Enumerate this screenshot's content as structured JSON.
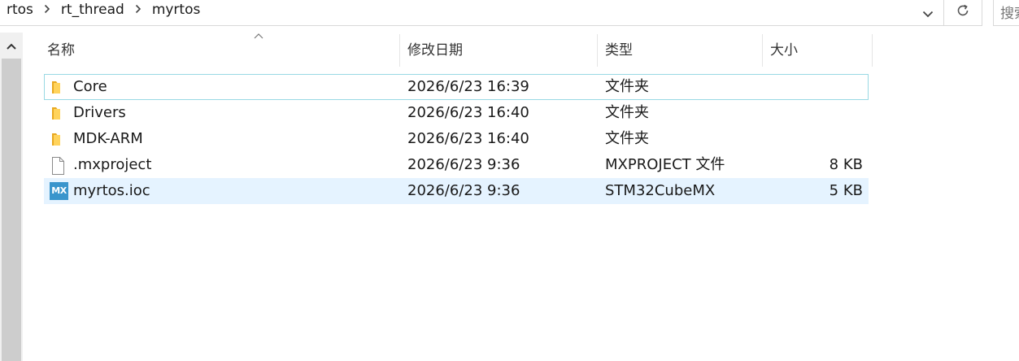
{
  "breadcrumb": {
    "items": [
      "rtos",
      "rt_thread",
      "myrtos"
    ]
  },
  "search": {
    "placeholder": "搜索"
  },
  "columns": {
    "name": "名称",
    "date": "修改日期",
    "type": "类型",
    "size": "大小"
  },
  "files": [
    {
      "name": "Core",
      "date": "2026/6/23 16:39",
      "type": "文件夹",
      "size": "",
      "icon": "folder-icon"
    },
    {
      "name": "Drivers",
      "date": "2026/6/23 16:40",
      "type": "文件夹",
      "size": "",
      "icon": "folder-icon"
    },
    {
      "name": "MDK-ARM",
      "date": "2026/6/23 16:40",
      "type": "文件夹",
      "size": "",
      "icon": "folder-icon"
    },
    {
      "name": ".mxproject",
      "date": "2026/6/23 9:36",
      "type": "MXPROJECT 文件",
      "size": "8 KB",
      "icon": "file-icon"
    },
    {
      "name": "myrtos.ioc",
      "date": "2026/6/23 9:36",
      "type": "STM32CubeMX",
      "size": "5 KB",
      "icon": "stm32cubemx-icon",
      "badge": "MX"
    }
  ],
  "colors": {
    "selected_row": "#e5f3ff",
    "focus_border": "#99d9e4",
    "folder": "#ffc73d",
    "mx_badge": "#3a95cc"
  }
}
